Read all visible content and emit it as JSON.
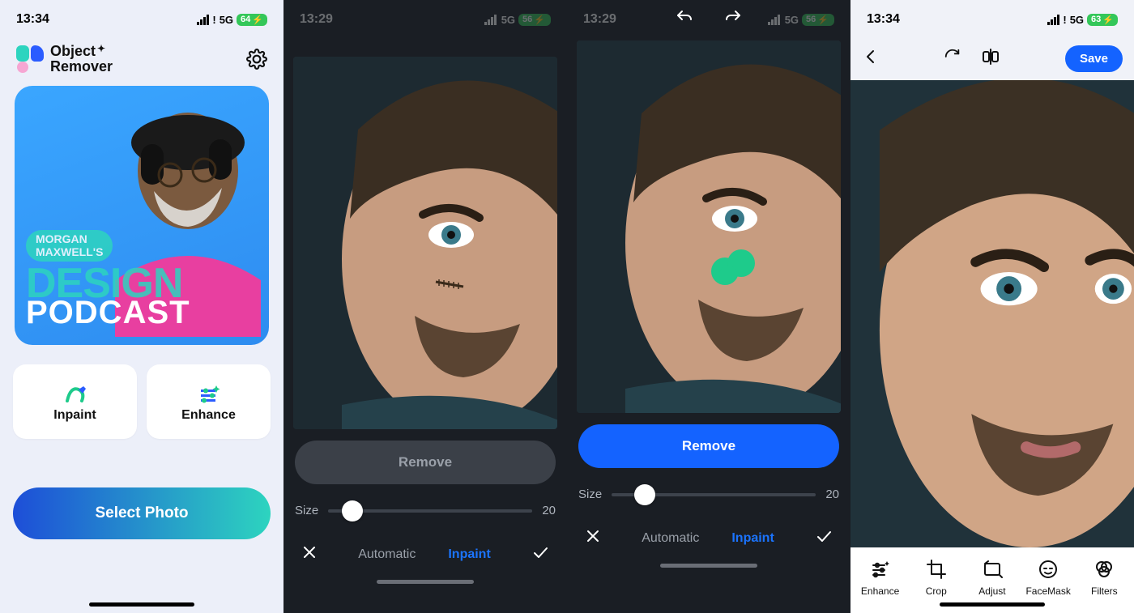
{
  "screen1": {
    "status": {
      "time": "13:34",
      "network": "5G",
      "battery": "64"
    },
    "app_name_line1": "Object",
    "app_name_line2": "Remover",
    "logo_star": "✦",
    "hero": {
      "line1": "MORGAN",
      "line2": "MAXWELL'S",
      "design": "DESIGN",
      "podcast": "PODCAST"
    },
    "actions": {
      "inpaint": "Inpaint",
      "enhance": "Enhance"
    },
    "select_photo": "Select Photo"
  },
  "screen2": {
    "status": {
      "time": "13:29",
      "network": "5G",
      "battery": "56"
    },
    "remove_label": "Remove",
    "size_label": "Size",
    "size_value": "20",
    "slider_percent": 12,
    "tabs": {
      "automatic": "Automatic",
      "inpaint": "Inpaint"
    }
  },
  "screen3": {
    "status": {
      "time": "13:29",
      "network": "5G",
      "battery": "56"
    },
    "remove_label": "Remove",
    "size_label": "Size",
    "size_value": "20",
    "slider_percent": 16,
    "tabs": {
      "automatic": "Automatic",
      "inpaint": "Inpaint"
    }
  },
  "screen4": {
    "status": {
      "time": "13:34",
      "network": "5G",
      "battery": "63"
    },
    "save_label": "Save",
    "tools": {
      "enhance": "Enhance",
      "crop": "Crop",
      "adjust": "Adjust",
      "facemask": "FaceMask",
      "filters": "Filters"
    }
  }
}
